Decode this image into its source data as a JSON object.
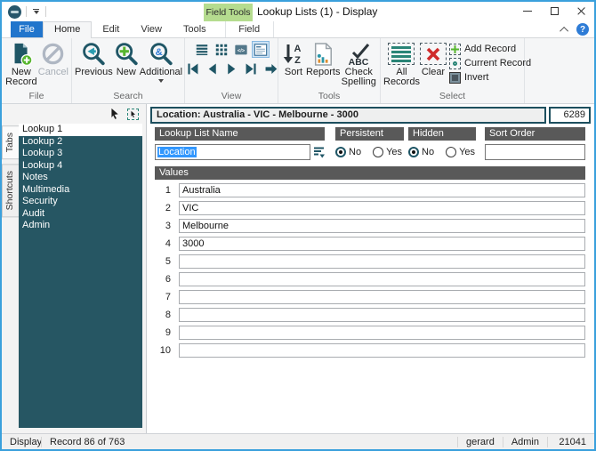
{
  "titlebar": {
    "contextual_header": "Field Tools",
    "title": "Lookup Lists (1) - Display"
  },
  "ribbon_tabs": {
    "file": "File",
    "home": "Home",
    "edit": "Edit",
    "view": "View",
    "tools": "Tools",
    "field": "Field"
  },
  "ribbon": {
    "file_group": {
      "label": "File",
      "new_record": "New Record",
      "cancel": "Cancel"
    },
    "search_group": {
      "label": "Search",
      "previous": "Previous",
      "new": "New",
      "additional": "Additional"
    },
    "view_group": {
      "label": "View"
    },
    "tools_group": {
      "label": "Tools",
      "sort": "Sort",
      "reports": "Reports",
      "check_spelling": "Check Spelling"
    },
    "select_group": {
      "label": "Select",
      "all_records": "All Records",
      "clear": "Clear",
      "add_record": "Add Record",
      "current_record": "Current Record",
      "invert": "Invert"
    }
  },
  "icons": {
    "sort_a": "A",
    "sort_z": "Z",
    "check_abc": "ABC",
    "additional_badge": "&",
    "code_view": "</>",
    "help": "?"
  },
  "sidebar": {
    "vertical_tabs": {
      "tabs": "Tabs",
      "shortcuts": "Shortcuts"
    },
    "items": [
      {
        "label": "Lookup 1",
        "selected": true
      },
      {
        "label": "Lookup 2"
      },
      {
        "label": "Lookup 3"
      },
      {
        "label": "Lookup 4"
      },
      {
        "label": "Notes"
      },
      {
        "label": "Multimedia"
      },
      {
        "label": "Security"
      },
      {
        "label": "Audit"
      },
      {
        "label": "Admin"
      }
    ]
  },
  "record": {
    "header": "Location: Australia - VIC - Melbourne - 3000",
    "number": "6289"
  },
  "form": {
    "name_label": "Lookup List Name",
    "name_value": "Location",
    "persistent_label": "Persistent",
    "hidden_label": "Hidden",
    "sort_order_label": "Sort Order",
    "sort_order_value": "",
    "option_no": "No",
    "option_yes": "Yes",
    "persistent_selected": "No",
    "hidden_selected": "No",
    "values_label": "Values",
    "values": [
      {
        "num": "1",
        "value": "Australia"
      },
      {
        "num": "2",
        "value": "VIC"
      },
      {
        "num": "3",
        "value": "Melbourne"
      },
      {
        "num": "4",
        "value": "3000"
      },
      {
        "num": "5",
        "value": ""
      },
      {
        "num": "6",
        "value": ""
      },
      {
        "num": "7",
        "value": ""
      },
      {
        "num": "8",
        "value": ""
      },
      {
        "num": "9",
        "value": ""
      },
      {
        "num": "10",
        "value": ""
      }
    ]
  },
  "statusbar": {
    "mode": "Display",
    "record_info": "Record 86 of 763",
    "user": "gerard",
    "role": "Admin",
    "id": "21041"
  },
  "colors": {
    "accent_teal": "#265663",
    "icon_teal": "#1f5666",
    "selection_blue": "#3297fd",
    "file_tab_blue": "#2175cc",
    "field_tools_green": "#b5dc8f",
    "window_border_blue": "#3aa0dc"
  }
}
